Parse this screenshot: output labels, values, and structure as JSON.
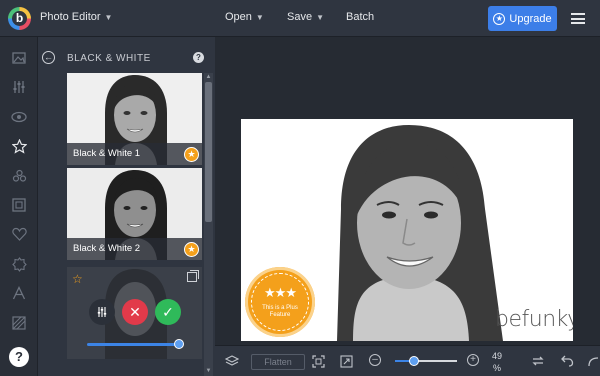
{
  "topbar": {
    "app_name": "Photo Editor",
    "open_label": "Open",
    "save_label": "Save",
    "batch_label": "Batch",
    "upgrade_label": "Upgrade",
    "logo_letter": "b"
  },
  "rail": {
    "icons": [
      "image-icon",
      "sliders-icon",
      "eye-icon",
      "star-icon",
      "effects-icon",
      "frame-icon",
      "heart-icon",
      "texture-icon",
      "text-icon",
      "pattern-icon"
    ],
    "active": "star-icon",
    "help_label": "?"
  },
  "panel": {
    "title": "BLACK & WHITE",
    "help_label": "?",
    "presets": [
      {
        "label": "Black & White 1",
        "plus": true
      },
      {
        "label": "Black & White 2",
        "plus": true
      }
    ],
    "active_card": {
      "strength_fraction": 1.0
    }
  },
  "canvas": {
    "plus_seal_text": "This is a Plus Feature",
    "watermark": "befunky"
  },
  "bottombar": {
    "flatten_label": "Flatten",
    "zoom_value": "49",
    "zoom_unit": "%",
    "zoom_fraction": 0.3
  },
  "colors": {
    "accent": "#3c7ee8",
    "plus_orange": "#f4a01b",
    "cancel_red": "#e23a4a",
    "apply_green": "#2fba5a"
  }
}
